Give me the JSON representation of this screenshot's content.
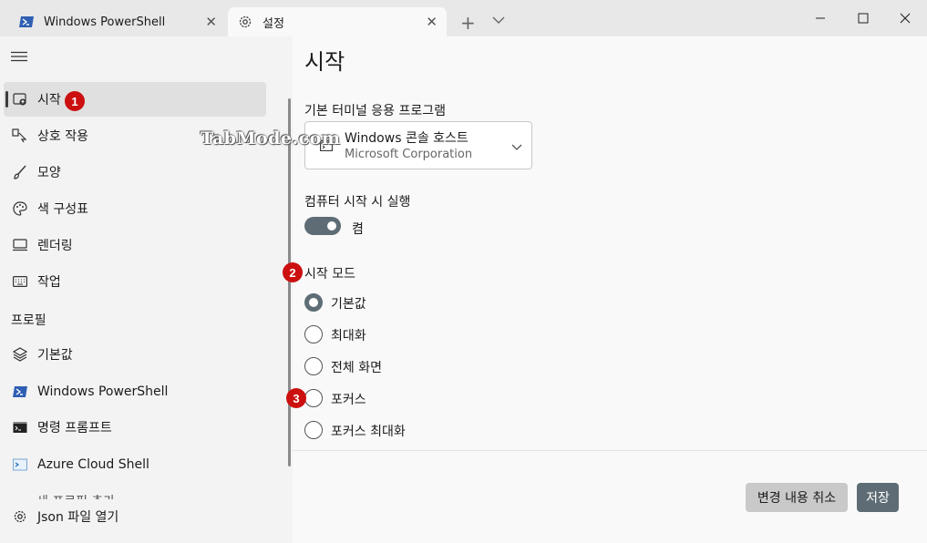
{
  "tabs": [
    {
      "label": "Windows PowerShell",
      "icon": "powershell-icon",
      "active": false
    },
    {
      "label": "설정",
      "icon": "gear-icon",
      "active": true
    }
  ],
  "sidebar": {
    "items": [
      {
        "label": "시작",
        "icon": "launch-icon",
        "selected": true
      },
      {
        "label": "상호 작용",
        "icon": "interaction-icon"
      },
      {
        "label": "모양",
        "icon": "brush-icon"
      },
      {
        "label": "색 구성표",
        "icon": "palette-icon"
      },
      {
        "label": "렌더링",
        "icon": "monitor-icon"
      },
      {
        "label": "작업",
        "icon": "keyboard-icon"
      }
    ],
    "profiles_header": "프로필",
    "profiles": [
      {
        "label": "기본값",
        "icon": "layers-icon"
      },
      {
        "label": "Windows PowerShell",
        "icon": "powershell-icon"
      },
      {
        "label": "명령 프롬프트",
        "icon": "cmd-icon"
      },
      {
        "label": "Azure Cloud Shell",
        "icon": "azure-icon"
      }
    ],
    "clipped_item": "새 프로필 추가",
    "bottom": {
      "label": "Json 파일 열기",
      "icon": "gear-icon"
    }
  },
  "main": {
    "title": "시작",
    "default_terminal": {
      "label": "기본 터미널 응용 프로그램",
      "value": "Windows 콘솔 호스트",
      "subvalue": "Microsoft Corporation"
    },
    "launch_on_startup": {
      "label": "컴퓨터 시작 시 실행",
      "state_label": "켬",
      "on": true
    },
    "launch_mode": {
      "label": "시작 모드",
      "options": [
        "기본값",
        "최대화",
        "전체 화면",
        "포커스",
        "포커스 최대화"
      ],
      "selected": "기본값"
    },
    "buttons": {
      "discard": "변경 내용 취소",
      "save": "저장"
    }
  },
  "annotations": {
    "badge1": "1",
    "badge2": "2",
    "badge3": "3",
    "watermark": "TabMode.com"
  },
  "colors": {
    "accent": "#5e6d75",
    "badge": "#cc1010"
  }
}
